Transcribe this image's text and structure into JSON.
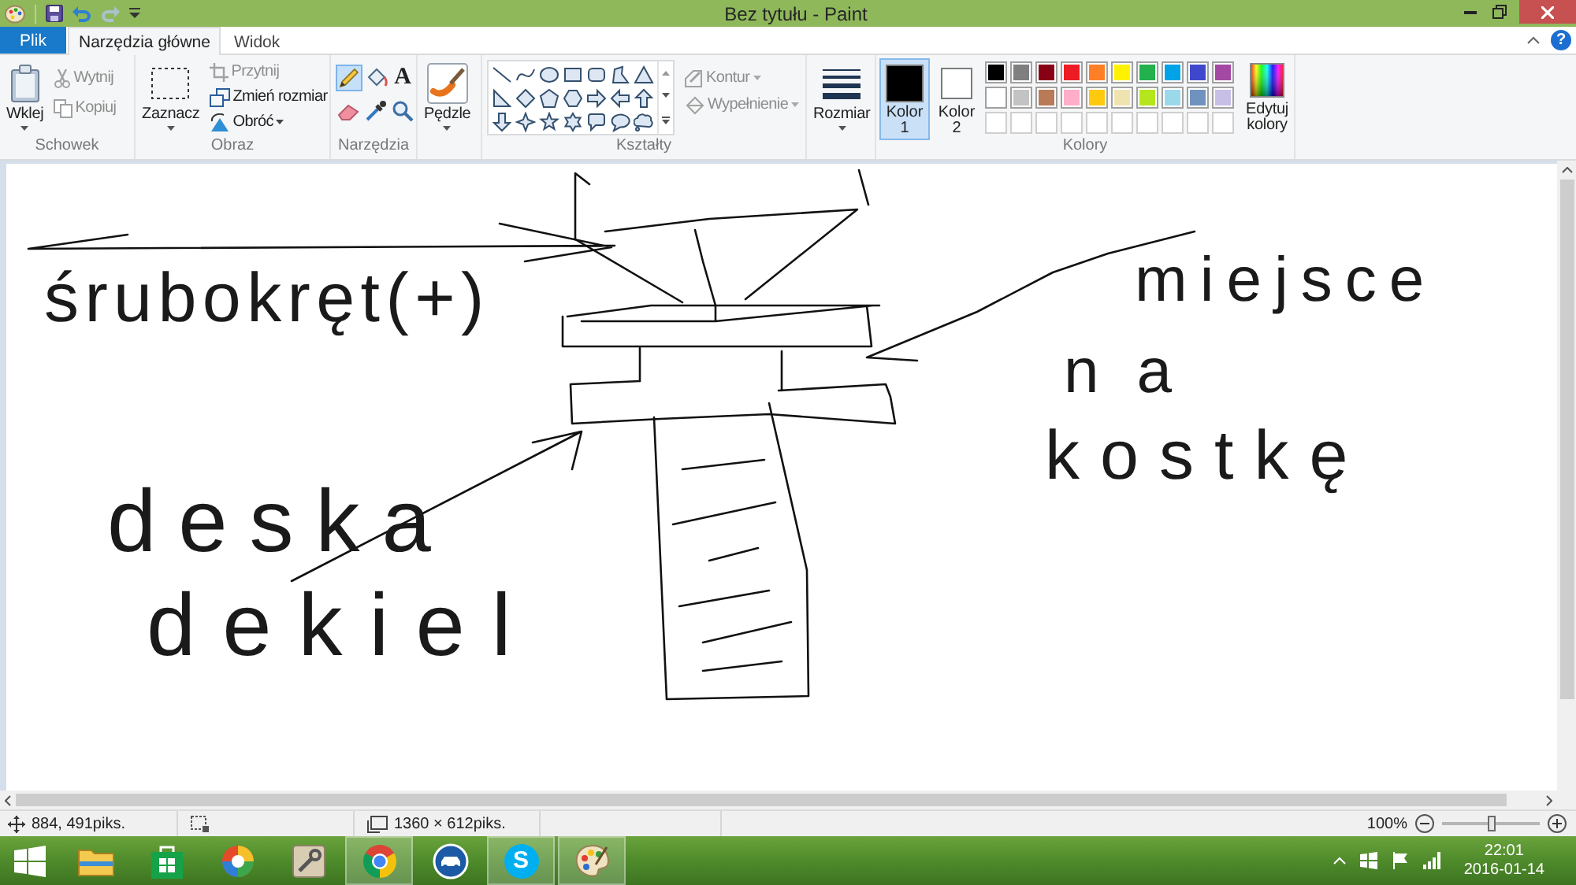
{
  "window": {
    "title": "Bez tytułu - Paint"
  },
  "tabs": [
    {
      "label": "Plik",
      "kind": "file",
      "selected": false
    },
    {
      "label": "Narzędzia główne",
      "kind": "tab",
      "selected": true
    },
    {
      "label": "Widok",
      "kind": "tab",
      "selected": false
    }
  ],
  "help": {
    "glyph": "?"
  },
  "ribbon": {
    "clipboard": {
      "title": "Schowek",
      "paste": {
        "label": "Wklej",
        "dropdown": true
      },
      "cut": {
        "label": "Wytnij",
        "disabled": true
      },
      "copy": {
        "label": "Kopiuj",
        "disabled": true
      }
    },
    "image": {
      "title": "Obraz",
      "select": {
        "label": "Zaznacz",
        "dropdown": true
      },
      "crop": {
        "label": "Przytnij",
        "disabled": true
      },
      "resize": {
        "label": "Zmień rozmiar",
        "disabled": false
      },
      "rotate": {
        "label": "Obróć",
        "disabled": false,
        "dropdown": true
      }
    },
    "tools": {
      "title": "Narzędzia",
      "items": [
        {
          "kind": "pencil",
          "selected": true
        },
        {
          "kind": "fill",
          "selected": false
        },
        {
          "kind": "text",
          "glyph": "A",
          "selected": false
        },
        {
          "kind": "eraser",
          "selected": false
        },
        {
          "kind": "picker",
          "selected": false
        },
        {
          "kind": "magnifier",
          "selected": false
        }
      ]
    },
    "brushes": {
      "label": "Pędzle",
      "dropdown": true
    },
    "shapes": {
      "title": "Kształty",
      "items": [
        {
          "kind": "line"
        },
        {
          "kind": "curve"
        },
        {
          "kind": "oval"
        },
        {
          "kind": "rectangle"
        },
        {
          "kind": "rounded-rectangle"
        },
        {
          "kind": "polygon"
        },
        {
          "kind": "triangle"
        },
        {
          "kind": "right-triangle"
        },
        {
          "kind": "diamond"
        },
        {
          "kind": "pentagon"
        },
        {
          "kind": "hexagon"
        },
        {
          "kind": "right-arrow"
        },
        {
          "kind": "left-arrow"
        },
        {
          "kind": "up-arrow"
        },
        {
          "kind": "down-arrow"
        },
        {
          "kind": "four-point-star"
        },
        {
          "kind": "five-point-star"
        },
        {
          "kind": "six-point-star"
        },
        {
          "kind": "rounded-callout"
        },
        {
          "kind": "oval-callout"
        },
        {
          "kind": "cloud-callout"
        }
      ],
      "outline": {
        "label": "Kontur",
        "disabled": true,
        "dropdown": true
      },
      "fill": {
        "label": "Wypełnienie",
        "disabled": true,
        "dropdown": true
      }
    },
    "size": {
      "label": "Rozmiar",
      "dropdown": true
    },
    "colors": {
      "title": "Kolory",
      "color_1": {
        "label": "Kolor 1",
        "color": "#000000",
        "selected": true
      },
      "color_2": {
        "label": "Kolor 2",
        "color": "#ffffff",
        "selected": false
      },
      "palette": [
        {
          "color": "#000000"
        },
        {
          "color": "#7f7f7f"
        },
        {
          "color": "#880015"
        },
        {
          "color": "#ed1c24"
        },
        {
          "color": "#ff7f27"
        },
        {
          "color": "#fff200"
        },
        {
          "color": "#22b14c"
        },
        {
          "color": "#00a2e8"
        },
        {
          "color": "#3f48cc"
        },
        {
          "color": "#a349a4"
        },
        {
          "color": "#ffffff"
        },
        {
          "color": "#c3c3c3"
        },
        {
          "color": "#b97a57"
        },
        {
          "color": "#ffaec9"
        },
        {
          "color": "#ffc90e"
        },
        {
          "color": "#efe4b0"
        },
        {
          "color": "#b5e61d"
        },
        {
          "color": "#99d9ea"
        },
        {
          "color": "#7092be"
        },
        {
          "color": "#c8bfe7"
        }
      ],
      "edit": {
        "label": "Edytuj kolory"
      }
    }
  },
  "canvas": {
    "annotations": [
      {
        "text": "śrubokręt(+)"
      },
      {
        "text": "deska"
      },
      {
        "text": "dekiel"
      },
      {
        "text": "miejsce"
      },
      {
        "text": "na"
      },
      {
        "text": "kostkę"
      }
    ]
  },
  "status_bar": {
    "cursor_position": "884, 491piks.",
    "image_size": "1360 × 612piks.",
    "zoom": "100%",
    "zoom_slider": {
      "level": 0.5
    }
  },
  "taskbar": {
    "apps": [
      {
        "kind": "folder",
        "running": false
      },
      {
        "kind": "bag",
        "running": false
      },
      {
        "kind": "orb",
        "running": false
      },
      {
        "kind": "tile",
        "running": false
      },
      {
        "kind": "tricolor",
        "running": true
      },
      {
        "kind": "car",
        "running": false
      },
      {
        "kind": "letter",
        "glyph": "S",
        "running": true
      },
      {
        "kind": "palette",
        "running": true
      }
    ],
    "clock": {
      "time": "22:01",
      "date": "2016-01-14"
    }
  }
}
